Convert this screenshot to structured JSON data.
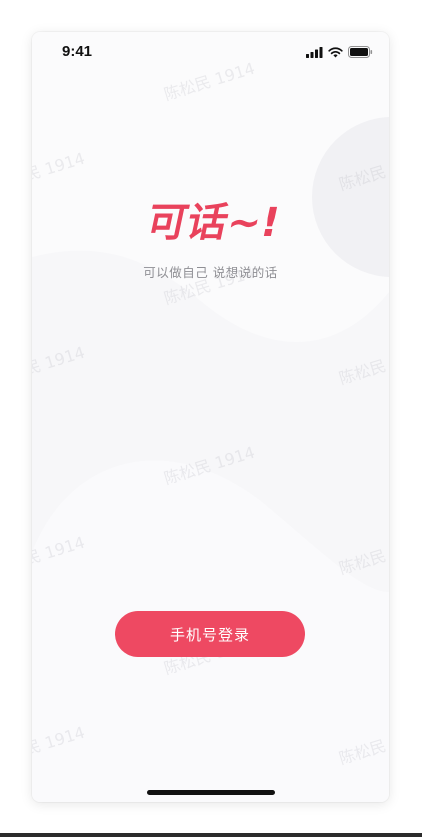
{
  "status_bar": {
    "time": "9:41"
  },
  "brand": {
    "title": "可话~!",
    "tagline": "可以做自己   说想说的话",
    "color": "#e9425c"
  },
  "login": {
    "button_label": "手机号登录",
    "color": "#ee4962"
  },
  "watermark": {
    "text": "陈松民 1914"
  }
}
